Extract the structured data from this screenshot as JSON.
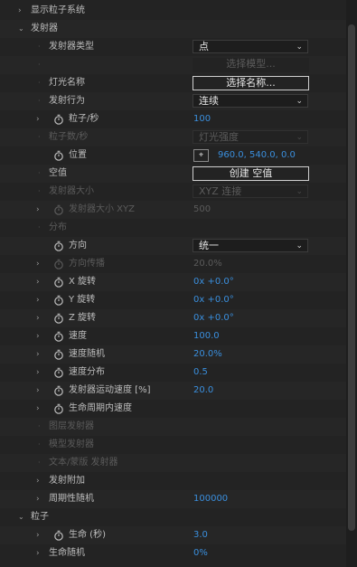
{
  "rows": [
    {
      "depth": 0,
      "toggle": "collapsed",
      "label": "显示粒子系统"
    },
    {
      "depth": 0,
      "toggle": "expanded",
      "label": "发射器"
    },
    {
      "depth": 1,
      "toggle": "none",
      "label": "发射器类型",
      "control": "select",
      "value": "点"
    },
    {
      "depth": 1,
      "toggle": "none",
      "label": "",
      "control": "button",
      "value": "选择模型...",
      "disabled": true
    },
    {
      "depth": 1,
      "toggle": "none",
      "label": "灯光名称",
      "control": "button",
      "value": "选择名称..."
    },
    {
      "depth": 1,
      "toggle": "none",
      "label": "发射行为",
      "control": "select",
      "value": "连续"
    },
    {
      "depth": 1,
      "toggle": "collapsed",
      "stopwatch": true,
      "label": "粒子/秒",
      "control": "number",
      "value": "100"
    },
    {
      "depth": 1,
      "toggle": "none",
      "label": "粒子数/秒",
      "disabled": true,
      "control": "select",
      "value": "灯光强度"
    },
    {
      "depth": 1,
      "toggle": "none",
      "stopwatch": true,
      "label": "位置",
      "control": "position",
      "value": "960.0, 540.0, 0.0",
      "icon": "crosshair-icon"
    },
    {
      "depth": 1,
      "toggle": "none",
      "label": "空值",
      "control": "button",
      "value": "创建 空值"
    },
    {
      "depth": 1,
      "toggle": "none",
      "label": "发射器大小",
      "disabled": true,
      "control": "select",
      "value": "XYZ 连接"
    },
    {
      "depth": 1,
      "toggle": "collapsed",
      "stopwatch": true,
      "label": "发射器大小 XYZ",
      "disabled": true,
      "control": "number",
      "value": "500"
    },
    {
      "depth": 1,
      "toggle": "none",
      "label": "分布",
      "disabled": true
    },
    {
      "depth": 1,
      "toggle": "none",
      "stopwatch": true,
      "label": "方向",
      "control": "select",
      "value": "统一"
    },
    {
      "depth": 1,
      "toggle": "collapsed",
      "stopwatch": true,
      "label": "方向传播",
      "disabled": true,
      "control": "number",
      "value": "20.0%"
    },
    {
      "depth": 1,
      "toggle": "collapsed",
      "stopwatch": true,
      "label": "X 旋转",
      "control": "number",
      "value": "0x +0.0°"
    },
    {
      "depth": 1,
      "toggle": "collapsed",
      "stopwatch": true,
      "label": "Y 旋转",
      "control": "number",
      "value": "0x +0.0°"
    },
    {
      "depth": 1,
      "toggle": "collapsed",
      "stopwatch": true,
      "label": "Z 旋转",
      "control": "number",
      "value": "0x +0.0°"
    },
    {
      "depth": 1,
      "toggle": "collapsed",
      "stopwatch": true,
      "label": "速度",
      "control": "number",
      "value": "100.0"
    },
    {
      "depth": 1,
      "toggle": "collapsed",
      "stopwatch": true,
      "label": "速度随机",
      "control": "number",
      "value": "20.0%"
    },
    {
      "depth": 1,
      "toggle": "collapsed",
      "stopwatch": true,
      "label": "速度分布",
      "control": "number",
      "value": "0.5"
    },
    {
      "depth": 1,
      "toggle": "collapsed",
      "stopwatch": true,
      "label": "发射器运动速度 [%]",
      "control": "number",
      "value": "20.0"
    },
    {
      "depth": 1,
      "toggle": "collapsed",
      "stopwatch": true,
      "label": "生命周期内速度"
    },
    {
      "depth": 1,
      "toggle": "none",
      "label": "图层发射器",
      "disabled": true
    },
    {
      "depth": 1,
      "toggle": "none",
      "label": "模型发射器",
      "disabled": true
    },
    {
      "depth": 1,
      "toggle": "none",
      "label": "文本/蒙版 发射器",
      "disabled": true
    },
    {
      "depth": 1,
      "toggle": "collapsed",
      "label": "发射附加"
    },
    {
      "depth": 1,
      "toggle": "collapsed",
      "label": "周期性随机",
      "control": "number",
      "value": "100000"
    },
    {
      "depth": 0,
      "toggle": "expanded",
      "label": "粒子"
    },
    {
      "depth": 1,
      "toggle": "collapsed",
      "stopwatch": true,
      "label": "生命 (秒)",
      "control": "number",
      "value": "3.0"
    },
    {
      "depth": 1,
      "toggle": "collapsed",
      "label": "生命随机",
      "control": "number",
      "value": "0%"
    }
  ]
}
